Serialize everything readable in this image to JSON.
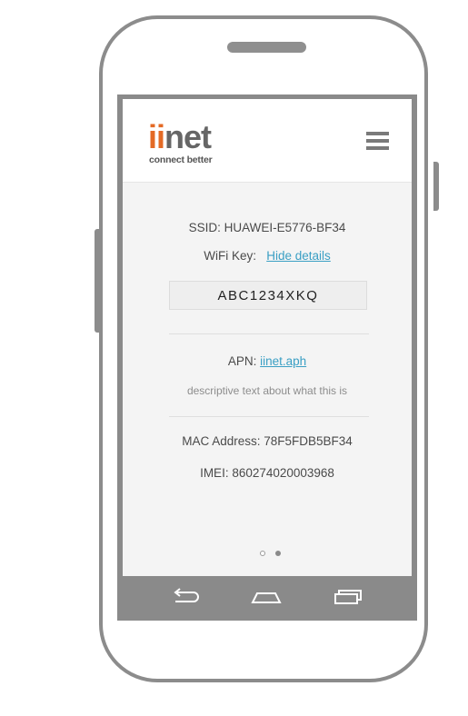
{
  "app": {
    "logo_main": "iinet",
    "logo_tagline": "connect better"
  },
  "wifi": {
    "ssid_line": "SSID: HUAWEI-E5776-BF34",
    "key_label": "WiFi Key:",
    "hide_details_link": "Hide details",
    "key_value": "ABC1234XKQ"
  },
  "apn": {
    "label": "APN:",
    "value_link": "iinet.aph",
    "description": "descriptive text about what this is"
  },
  "device": {
    "mac_line": "MAC Address: 78F5FDB5BF34",
    "imei_line": "IMEI: 860274020003968"
  },
  "pager": {
    "pages": 2,
    "active_index": 1
  },
  "colors": {
    "brand_orange": "#e46a25",
    "link_blue": "#3a9fc4",
    "frame_gray": "#8a8a8a"
  },
  "icons": [
    "menu-icon",
    "back-icon",
    "home-icon",
    "recent-apps-icon"
  ]
}
